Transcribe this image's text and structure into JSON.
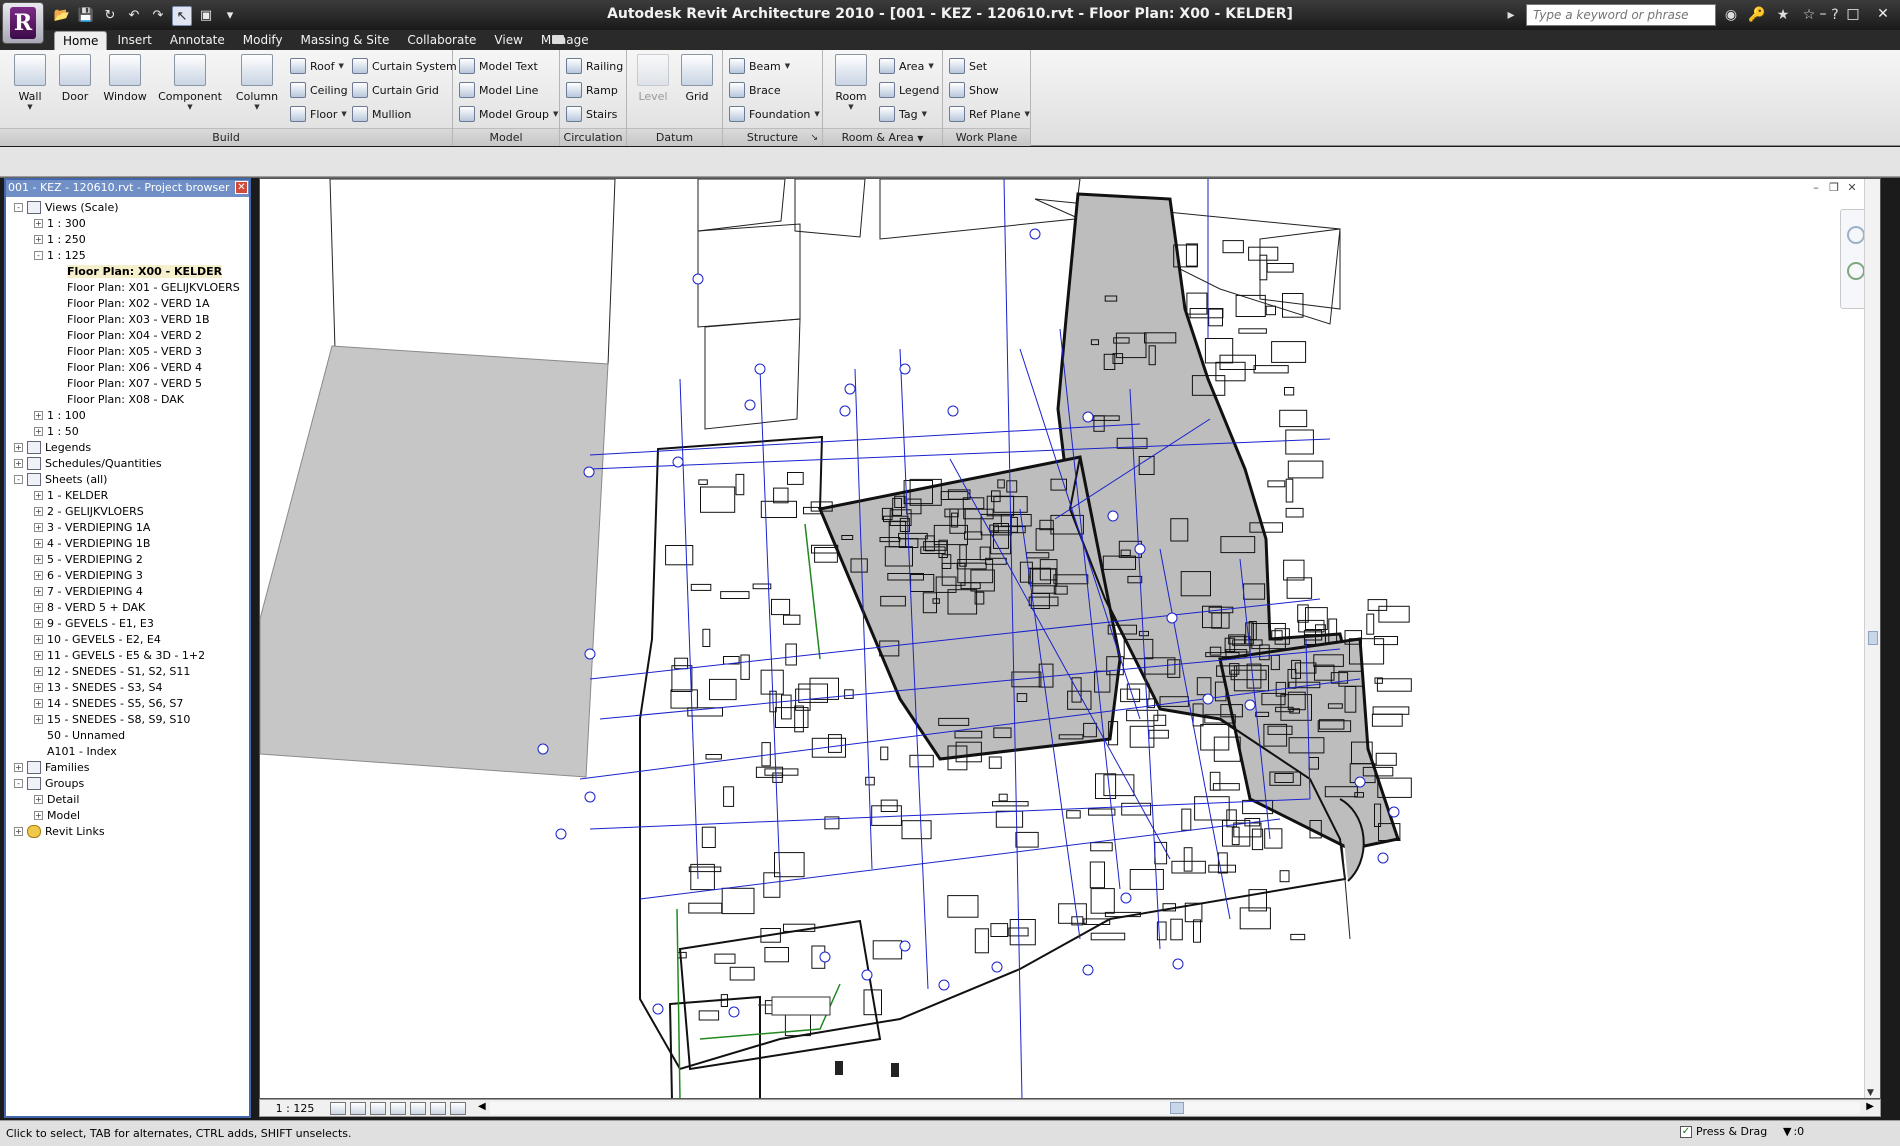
{
  "window": {
    "title": "Autodesk Revit Architecture 2010 - [001 - KEZ - 120610.rvt - Floor Plan: X00 - KELDER]",
    "app_letter": "R"
  },
  "quick_access": [
    "open-icon",
    "save-icon",
    "sync-icon",
    "undo-icon",
    "redo-icon",
    "select-icon",
    "view-icon",
    "dropdown-icon"
  ],
  "search": {
    "placeholder": "Type a keyword or phrase"
  },
  "tabs": [
    "Home",
    "Insert",
    "Annotate",
    "Modify",
    "Massing & Site",
    "Collaborate",
    "View",
    "Manage"
  ],
  "active_tab": "Home",
  "ribbon": {
    "build": {
      "title": "Build",
      "wall": "Wall",
      "door": "Door",
      "window": "Window",
      "component": "Component",
      "column": "Column",
      "roof": "Roof",
      "ceiling": "Ceiling",
      "floor": "Floor",
      "curtain_system": "Curtain System",
      "curtain_grid": "Curtain Grid",
      "mullion": "Mullion"
    },
    "model": {
      "title": "Model",
      "model_text": "Model Text",
      "model_line": "Model Line",
      "model_group": "Model Group"
    },
    "circulation": {
      "title": "Circulation",
      "railing": "Railing",
      "ramp": "Ramp",
      "stairs": "Stairs"
    },
    "datum": {
      "title": "Datum",
      "level": "Level",
      "grid": "Grid"
    },
    "structure": {
      "title": "Structure",
      "beam": "Beam",
      "brace": "Brace",
      "foundation": "Foundation"
    },
    "room_area": {
      "title": "Room & Area",
      "room": "Room",
      "area": "Area",
      "legend": "Legend",
      "tag": "Tag"
    },
    "work_plane": {
      "title": "Work Plane",
      "set": "Set",
      "show": "Show",
      "ref_plane": "Ref Plane"
    }
  },
  "browser": {
    "title": "001 - KEZ - 120610.rvt - Project browser",
    "views_scale": "Views (Scale)",
    "scale_300": "1 : 300",
    "scale_250": "1 : 250",
    "scale_125": "1 : 125",
    "floor_plans": [
      "Floor Plan: X00 - KELDER",
      "Floor Plan: X01 - GELIJKVLOERS",
      "Floor Plan: X02 - VERD 1A",
      "Floor Plan: X03 - VERD 1B",
      "Floor Plan: X04 - VERD 2",
      "Floor Plan: X05 - VERD 3",
      "Floor Plan: X06 - VERD 4",
      "Floor Plan: X07 - VERD 5",
      "Floor Plan: X08 - DAK"
    ],
    "scale_100": "1 : 100",
    "scale_50": "1 : 50",
    "legends": "Legends",
    "schedules": "Schedules/Quantities",
    "sheets_all": "Sheets (all)",
    "sheets": [
      "1 - KELDER",
      "2 - GELIJKVLOERS",
      "3 - VERDIEPING 1A",
      "4 - VERDIEPING 1B",
      "5 - VERDIEPING 2",
      "6 - VERDIEPING 3",
      "7 - VERDIEPING 4",
      "8 - VERD 5 + DAK",
      "9 - GEVELS - E1, E3",
      "10 - GEVELS - E2, E4",
      "11 - GEVELS - E5 & 3D - 1+2",
      "12 - SNEDES - S1, S2, S11",
      "13 - SNEDES - S3, S4",
      "14 - SNEDES - S5, S6, S7",
      "15 - SNEDES - S8, S9, S10",
      "50 - Unnamed",
      "A101 - Index"
    ],
    "families": "Families",
    "groups": "Groups",
    "detail": "Detail",
    "model": "Model",
    "revit_links": "Revit Links"
  },
  "viewbar": {
    "scale": "1 : 125"
  },
  "status": {
    "hint": "Click to select, TAB for alternates, CTRL adds, SHIFT unselects.",
    "press_drag": "Press & Drag",
    "filter_count": ":0"
  },
  "colors": {
    "grid_lines": "#1a22cc",
    "shaded_area": "#c6c6c6",
    "browser_header": "#6f8fc6"
  }
}
